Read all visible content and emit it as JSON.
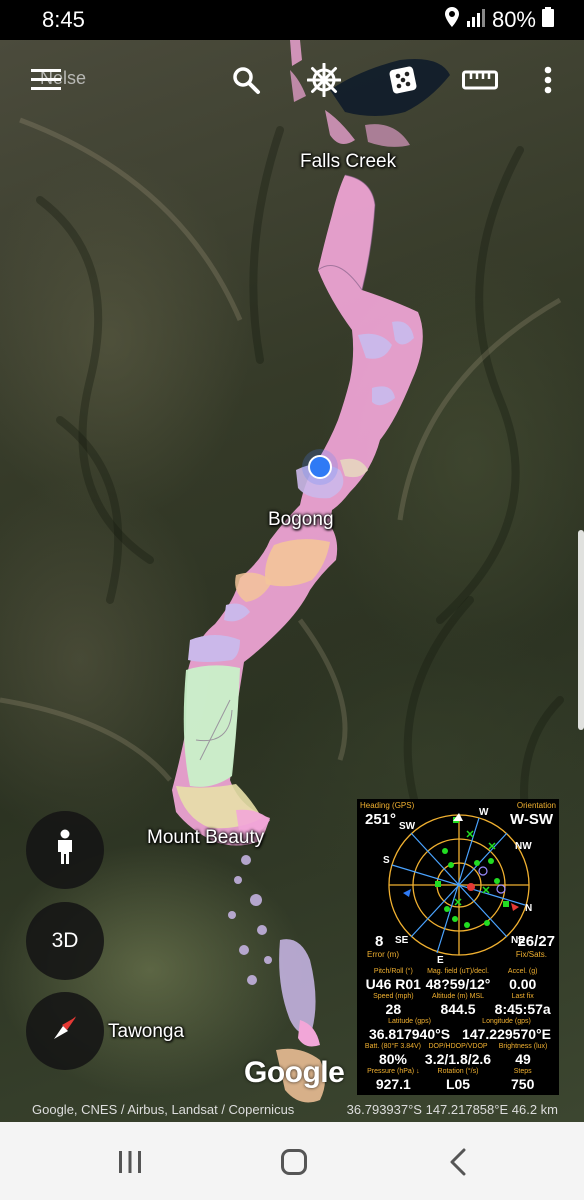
{
  "status_bar": {
    "time": "8:45",
    "battery": "80%",
    "icons": [
      "location-icon",
      "signal-icon",
      "battery-icon"
    ]
  },
  "toolbar": {
    "search_ghost_text": "Nelse",
    "icons": [
      "menu-icon",
      "search-icon",
      "helm-icon",
      "dice-icon",
      "ruler-icon",
      "more-icon"
    ]
  },
  "map": {
    "places": {
      "falls_creek": "Falls Creek",
      "bogong": "Bogong",
      "mount_beauty": "Mount Beauty",
      "tawonga": "Tawonga"
    },
    "attribution": "Google, CNES / Airbus, Landsat / Copernicus",
    "footer_coords": "36.793937°S 147.217858°E 46.2 km",
    "logo": "Google",
    "colors": {
      "pink": "#f2a6d8",
      "lilac": "#cbb8ea",
      "peach": "#f3c49a",
      "mint": "#c9f0c9",
      "location_blue": "#2f7af5"
    }
  },
  "fabs": {
    "person_icon": "person-icon",
    "three_d_label": "3D",
    "compass_icon": "compass-icon"
  },
  "gps_panel": {
    "heading_label": "Heading (GPS)",
    "heading_value": "251°",
    "orientation_label": "Orientation",
    "orientation_value": "W-SW",
    "error_value": "8",
    "error_label": "Error (m)",
    "fix_value": "26/27",
    "fix_label": "Fix/Sats.",
    "rows": [
      [
        {
          "label": "Pitch/Roll (°)",
          "value": "U46 R01"
        },
        {
          "label": "Mag. field (uT)/decl.",
          "value": "48?59/12°"
        },
        {
          "label": "Accel. (g)",
          "value": "0.00"
        }
      ],
      [
        {
          "label": "Speed (mph)",
          "value": "28"
        },
        {
          "label": "Altitude (m) MSL",
          "value": "844.5"
        },
        {
          "label": "Last fix",
          "value": "8:45:57a"
        }
      ],
      [
        {
          "label": "Latitude (gps)",
          "value": "36.817940°S"
        },
        {
          "label": "Longitude (gps)",
          "value": "147.229570°E"
        }
      ],
      [
        {
          "label": "Batt. (80°F 3.84V)",
          "value": "80%"
        },
        {
          "label": "DOP/HDOP/VDOP",
          "value": "3.2/1.8/2.6"
        },
        {
          "label": "Brightness (lux)",
          "value": "49"
        }
      ],
      [
        {
          "label": "Pressure (hPa) ↓",
          "value": "927.1"
        },
        {
          "label": "Rotation (°/s)",
          "value": "L05"
        },
        {
          "label": "Steps",
          "value": "750"
        }
      ]
    ],
    "compass_labels": [
      "N",
      "NE",
      "E",
      "SE",
      "S",
      "SW",
      "W",
      "NW"
    ],
    "colors": {
      "accent": "#f0b030",
      "sat": "#22dd22",
      "ring": "#f0b030"
    }
  },
  "navbar": {
    "icons": [
      "recents-icon",
      "home-icon",
      "back-icon"
    ]
  }
}
